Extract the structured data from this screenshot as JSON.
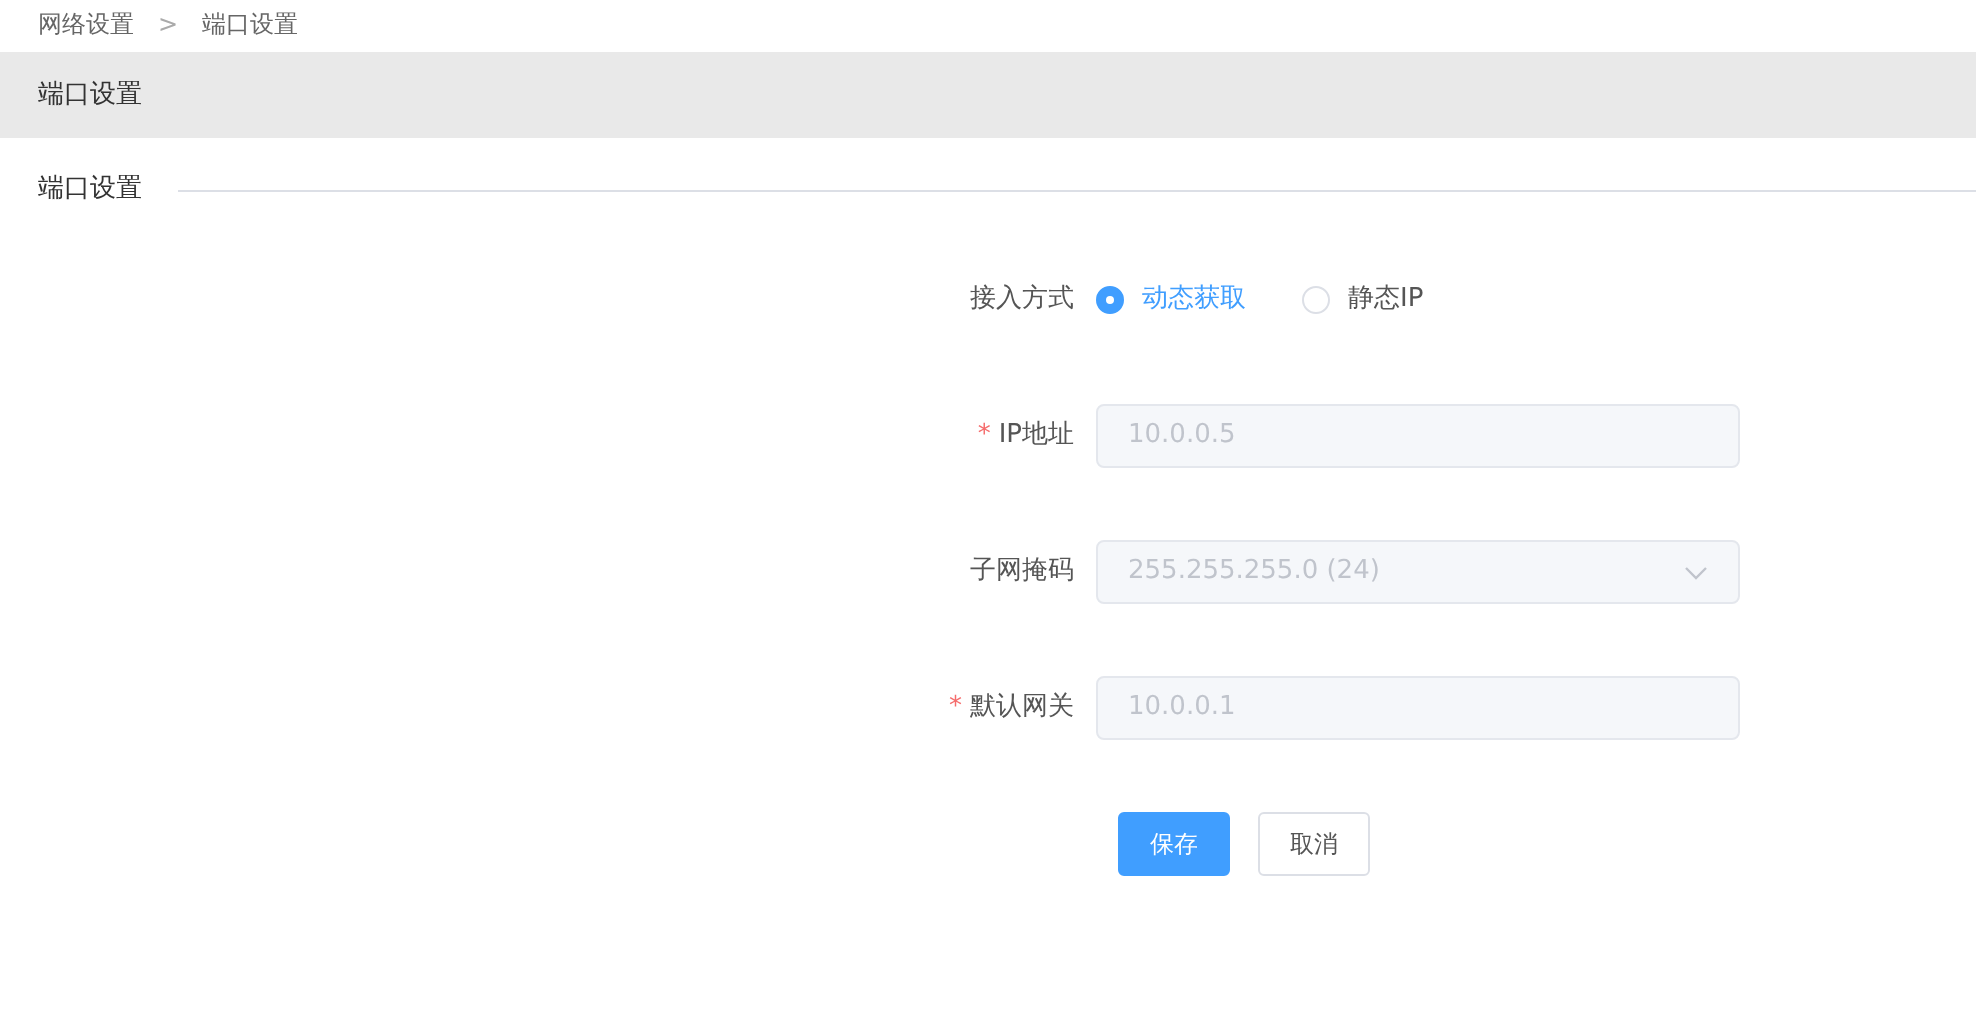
{
  "breadcrumb": [
    {
      "label": "网络设置"
    },
    {
      "label": ">"
    },
    {
      "label": "端口设置"
    }
  ],
  "header": {
    "title": "端口设置"
  },
  "section": {
    "title": "端口设置"
  },
  "form": {
    "fields": [
      {
        "kind": "radio",
        "label": "接入方式",
        "options": [
          {
            "label": "动态获取",
            "selected": true
          },
          {
            "label": "静态IP",
            "selected": false
          }
        ]
      },
      {
        "kind": "input",
        "label": "IP地址",
        "required_mark": "*",
        "value": "10.0.0.5",
        "disabled": true
      },
      {
        "kind": "select",
        "label": "子网掩码",
        "value": "255.255.255.0 (24)",
        "disabled": true
      },
      {
        "kind": "input",
        "label": "默认网关",
        "required_mark": "*",
        "value": "10.0.0.1",
        "disabled": true
      }
    ],
    "buttons": [
      {
        "label": "保存",
        "kind": "primary"
      },
      {
        "label": "取消",
        "kind": "default"
      }
    ]
  }
}
